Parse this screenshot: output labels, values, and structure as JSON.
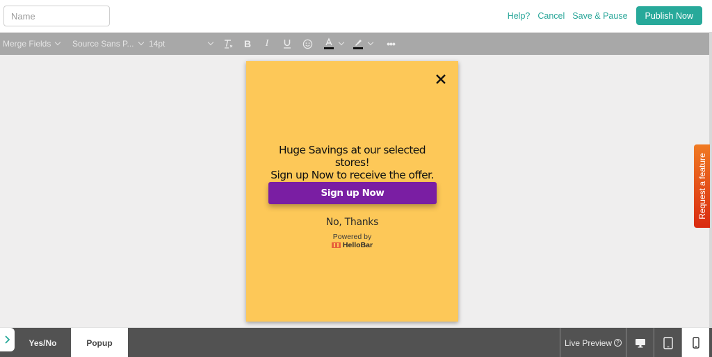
{
  "header": {
    "name_placeholder": "Name",
    "name_value": "",
    "help_label": "Help?",
    "cancel_label": "Cancel",
    "save_pause_label": "Save & Pause",
    "publish_label": "Publish Now"
  },
  "toolbar": {
    "merge_fields_label": "Merge Fields",
    "font_family_label": "Source Sans P...",
    "font_size_label": "14pt",
    "icons": [
      "chevron-down-icon",
      "clear-format-icon",
      "bold-icon",
      "italic-icon",
      "underline-icon",
      "emoji-icon",
      "text-color-icon",
      "highlight-icon",
      "more-icon"
    ]
  },
  "popup": {
    "close_icon": "close-icon",
    "headline_line1": "Huge Savings at our selected",
    "headline_line2": "stores!",
    "headline_line3": "Sign up Now to receive the offer.",
    "cta_label": "Sign up Now",
    "decline_label": "No, Thanks",
    "powered_by_label": "Powered by",
    "brand_label": "HelloBar",
    "background_color": "#fdc858",
    "cta_color": "#7a1ea3"
  },
  "side_tab": {
    "label": "Request a feature"
  },
  "bottom_bar": {
    "tabs": [
      {
        "label": "Yes/No",
        "active": false
      },
      {
        "label": "Popup",
        "active": true
      }
    ],
    "live_preview_label": "Live Preview",
    "devices": [
      {
        "name": "desktop",
        "active": false
      },
      {
        "name": "tablet",
        "active": false
      },
      {
        "name": "mobile",
        "active": true
      }
    ]
  },
  "colors": {
    "accent": "#27a99a",
    "toolbar_bg": "#a8a8a8",
    "bottom_bar_bg": "#525252"
  }
}
